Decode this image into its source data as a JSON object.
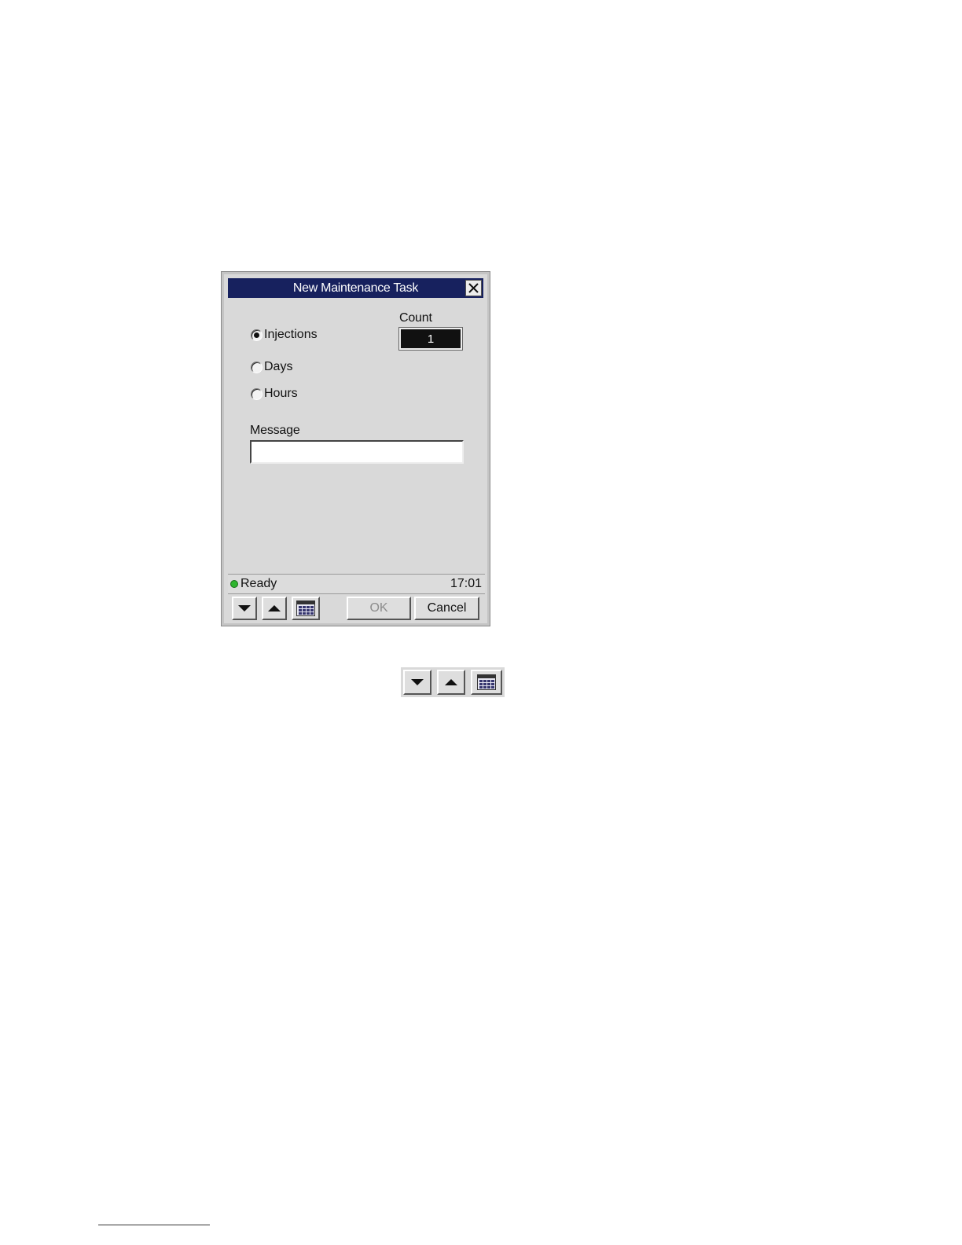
{
  "dialog": {
    "title": "New Maintenance Task",
    "close_icon": "close-icon",
    "count_label": "Count",
    "count_value": "1",
    "radios": [
      {
        "label": "Injections",
        "checked": true
      },
      {
        "label": "Days",
        "checked": false
      },
      {
        "label": "Hours",
        "checked": false
      }
    ],
    "message_label": "Message",
    "message_value": ""
  },
  "status": {
    "text": "Ready",
    "time": "17:01",
    "indicator_color": "#2fb52f"
  },
  "toolbar": {
    "down_icon": "arrow-down-icon",
    "up_icon": "arrow-up-icon",
    "keypad_icon": "keypad-icon",
    "ok_label": "OK",
    "cancel_label": "Cancel"
  },
  "colors": {
    "titlebar": "#17215e",
    "dialog_bg": "#d9d9d9"
  }
}
